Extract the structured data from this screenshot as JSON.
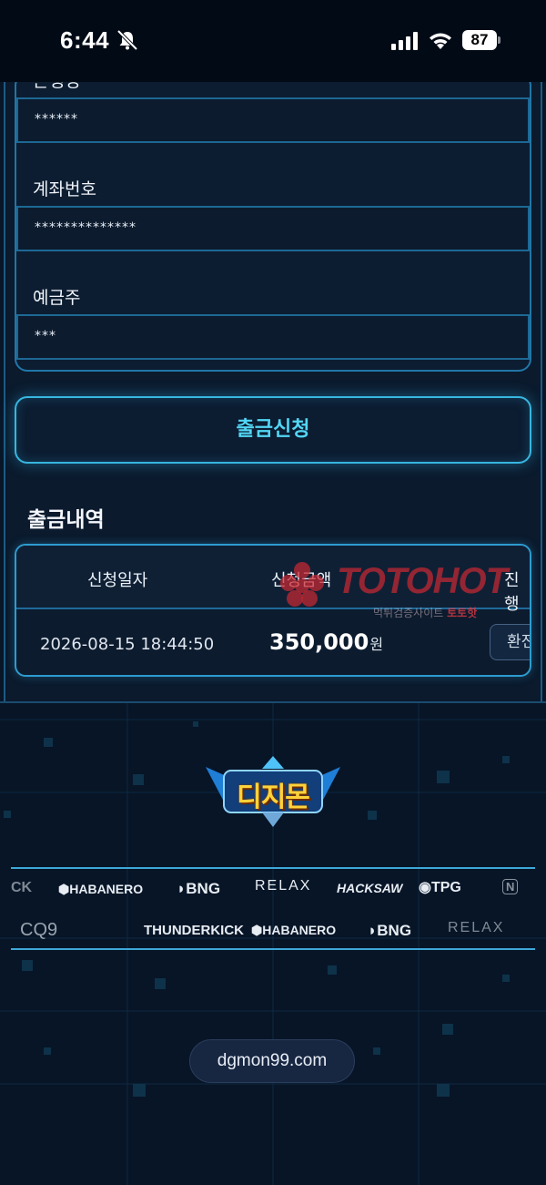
{
  "status_bar": {
    "time": "6:44",
    "battery": "87",
    "icons": [
      "bell-slash-icon",
      "signal-icon",
      "wifi-icon",
      "battery-icon"
    ]
  },
  "form": {
    "partial_label": "은행명",
    "fields": [
      {
        "label": "",
        "value": "******"
      },
      {
        "label": "계좌번호",
        "value": "**************"
      },
      {
        "label": "예금주",
        "value": "***"
      }
    ]
  },
  "withdraw_button": "출금신청",
  "history": {
    "title": "출금내역",
    "columns": [
      "신청일자",
      "신청금액",
      "진행"
    ],
    "rows": [
      {
        "date": "2026-08-15 18:44:50",
        "amount": "350,000",
        "unit": "원",
        "status": "환전"
      }
    ]
  },
  "watermark": {
    "brand": "TOTOHOT",
    "subtitle": "먹튀검증사이트",
    "subtitle_red": "토토핫"
  },
  "footer": {
    "logo_text": "디지몬",
    "providers_row1": [
      "CK",
      "HABANERO",
      "BNG",
      "RELAX",
      "HACKSAW",
      "TPG",
      "N"
    ],
    "providers_row2": [
      "CQ9",
      "THUNDERKICK",
      "HABANERO",
      "BNG",
      "RELAX"
    ],
    "domain": "dgmon99.com"
  },
  "colors": {
    "accent": "#52d6f4",
    "border": "#2d9cd0",
    "background": "#081628"
  }
}
